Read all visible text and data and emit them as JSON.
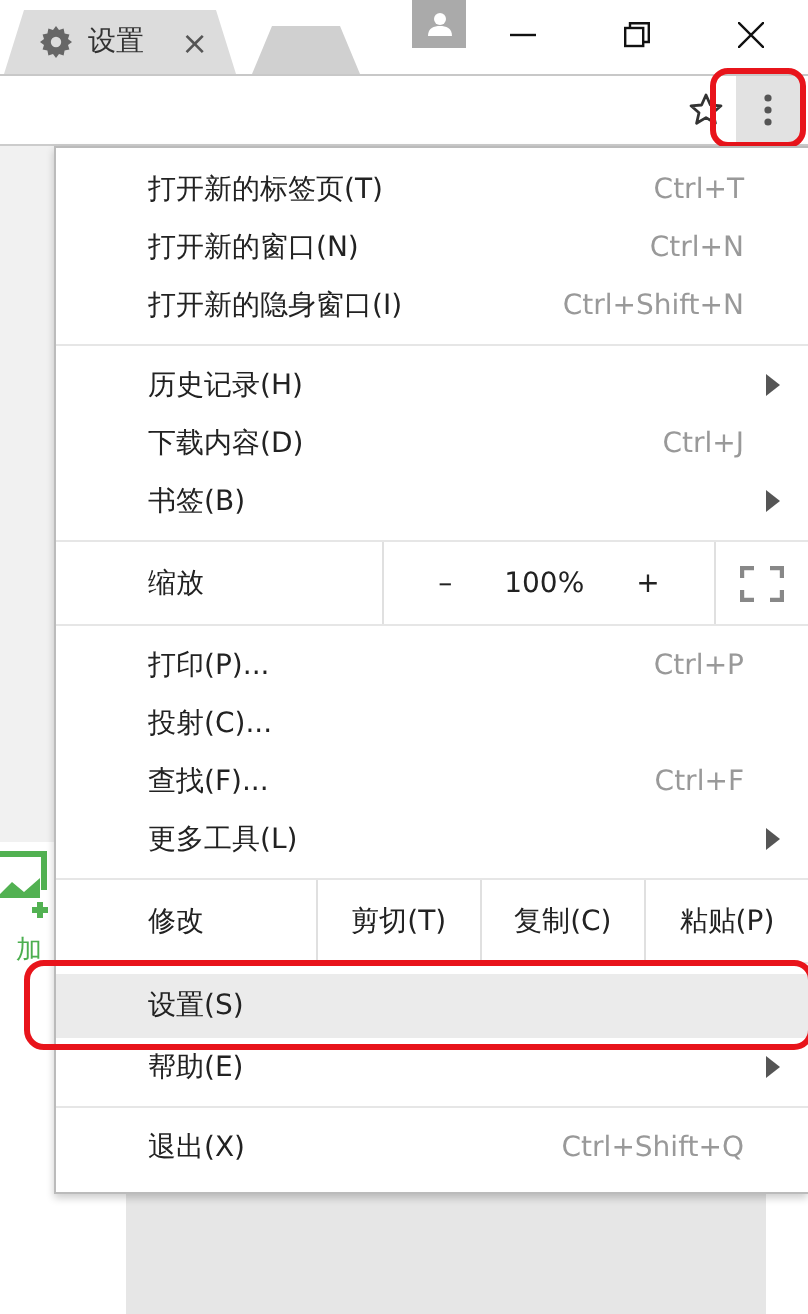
{
  "tabs": [
    {
      "label": "设置",
      "close": "×",
      "selected": true
    },
    {
      "selected": false
    }
  ],
  "toolbar": {
    "bookmarked": false,
    "menu_button_highlighted": true
  },
  "page": {
    "side_label": "加"
  },
  "menu": {
    "groups": [
      [
        {
          "kind": "item",
          "label": "打开新的标签页(T)",
          "shortcut": "Ctrl+T",
          "submenu": false,
          "highlighted": false
        },
        {
          "kind": "item",
          "label": "打开新的窗口(N)",
          "shortcut": "Ctrl+N",
          "submenu": false,
          "highlighted": false
        },
        {
          "kind": "item",
          "label": "打开新的隐身窗口(I)",
          "shortcut": "Ctrl+Shift+N",
          "submenu": false,
          "highlighted": false
        }
      ],
      [
        {
          "kind": "item",
          "label": "历史记录(H)",
          "submenu": true,
          "highlighted": false
        },
        {
          "kind": "item",
          "label": "下载内容(D)",
          "shortcut": "Ctrl+J",
          "submenu": false,
          "highlighted": false
        },
        {
          "kind": "item",
          "label": "书签(B)",
          "submenu": true,
          "highlighted": false
        }
      ],
      [
        {
          "kind": "zoom",
          "label": "缩放",
          "minus": "–",
          "value": "100%",
          "plus": "+"
        }
      ],
      [
        {
          "kind": "item",
          "label": "打印(P)...",
          "shortcut": "Ctrl+P",
          "submenu": false,
          "highlighted": false
        },
        {
          "kind": "item",
          "label": "投射(C)...",
          "submenu": false,
          "highlighted": false
        },
        {
          "kind": "item",
          "label": "查找(F)...",
          "shortcut": "Ctrl+F",
          "submenu": false,
          "highlighted": false
        },
        {
          "kind": "item",
          "label": "更多工具(L)",
          "submenu": true,
          "highlighted": false
        }
      ],
      [
        {
          "kind": "edit",
          "label": "修改",
          "buttons": [
            "剪切(T)",
            "复制(C)",
            "粘贴(P)"
          ]
        }
      ],
      [
        {
          "kind": "item",
          "label": "设置(S)",
          "submenu": false,
          "highlighted": true
        },
        {
          "kind": "item",
          "label": "帮助(E)",
          "submenu": true,
          "highlighted": false
        }
      ],
      [
        {
          "kind": "item",
          "label": "退出(X)",
          "shortcut": "Ctrl+Shift+Q",
          "submenu": false,
          "highlighted": false
        }
      ]
    ]
  }
}
